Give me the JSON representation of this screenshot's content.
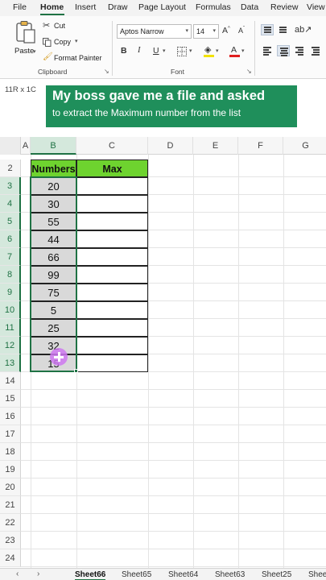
{
  "menu": {
    "items": [
      "File",
      "Home",
      "Insert",
      "Draw",
      "Page Layout",
      "Formulas",
      "Data",
      "Review",
      "View"
    ],
    "active": "Home"
  },
  "ribbon": {
    "clipboard": {
      "paste": "Paste",
      "cut": "Cut",
      "copy": "Copy",
      "format_painter": "Format Painter",
      "label": "Clipboard"
    },
    "font": {
      "name": "Aptos Narrow",
      "size": "14",
      "grow": "A",
      "shrink": "A",
      "bold": "B",
      "italic": "I",
      "underline": "U",
      "color_letter": "A",
      "label": "Font",
      "fill_color": "#f2e200",
      "font_color": "#e02020"
    }
  },
  "namebox": "11R x 1C",
  "banner": {
    "line1": "My boss gave me a file and asked",
    "line2": "to extract the Maximum number from the list"
  },
  "grid": {
    "columns": [
      "A",
      "B",
      "C",
      "D",
      "E",
      "F",
      "G"
    ],
    "rows": [
      "2",
      "3",
      "4",
      "5",
      "6",
      "7",
      "8",
      "9",
      "10",
      "11",
      "12",
      "13",
      "14",
      "15",
      "16",
      "17",
      "18",
      "19",
      "20",
      "21",
      "22",
      "23",
      "24"
    ],
    "header_numbers": "Numbers",
    "header_max": "Max",
    "numbers": [
      "20",
      "30",
      "55",
      "44",
      "66",
      "99",
      "75",
      "5",
      "25",
      "32",
      "15"
    ],
    "header_color": "#6ed32f",
    "accent_color": "#1f7244"
  },
  "sheets": {
    "tabs": [
      "Sheet66",
      "Sheet65",
      "Sheet64",
      "Sheet63",
      "Sheet25",
      "Shee"
    ],
    "active": "Sheet66"
  }
}
